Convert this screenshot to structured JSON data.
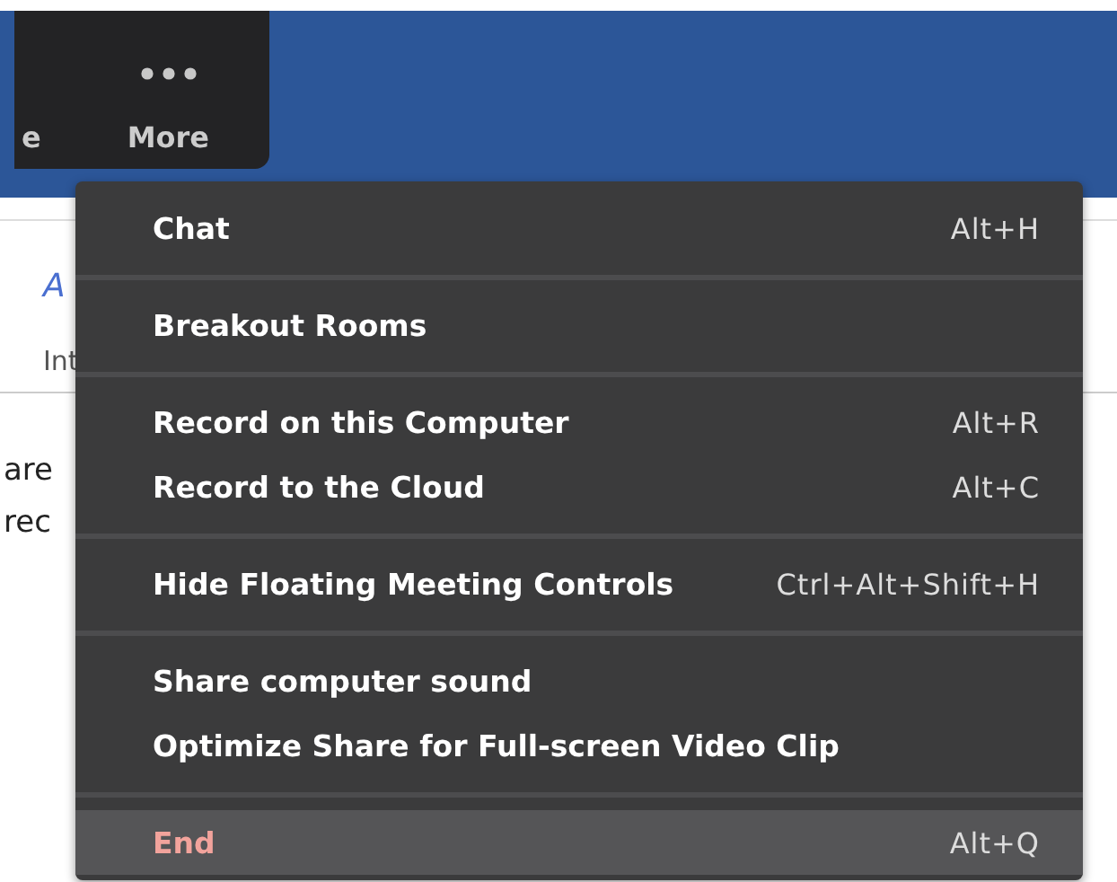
{
  "toolbar": {
    "buttons": [
      {
        "label": "e",
        "kind": "plain"
      },
      {
        "label": "More",
        "kind": "more"
      }
    ]
  },
  "document": {
    "styles": [
      {
        "preview": "A",
        "name": "Int"
      }
    ],
    "body_lines": [
      "are",
      "rec"
    ]
  },
  "menu": {
    "items": [
      {
        "kind": "item",
        "label": "Chat",
        "shortcut": "Alt+H",
        "selected": false
      },
      {
        "kind": "separator"
      },
      {
        "kind": "item",
        "label": "Breakout Rooms",
        "selected": false
      },
      {
        "kind": "separator"
      },
      {
        "kind": "item",
        "label": "Record on this Computer",
        "shortcut": "Alt+R",
        "selected": false
      },
      {
        "kind": "item",
        "label": "Record to the Cloud",
        "shortcut": "Alt+C",
        "selected": false
      },
      {
        "kind": "separator"
      },
      {
        "kind": "item",
        "label": "Hide Floating Meeting Controls",
        "shortcut": "Ctrl+Alt+Shift+H",
        "selected": false
      },
      {
        "kind": "separator"
      },
      {
        "kind": "item",
        "label": "Share computer sound",
        "selected": false
      },
      {
        "kind": "item",
        "label": "Optimize Share for Full-screen Video Clip",
        "selected": false
      },
      {
        "kind": "separator"
      },
      {
        "kind": "danger",
        "label": "End",
        "shortcut": "Alt+Q",
        "selected": true
      }
    ]
  }
}
